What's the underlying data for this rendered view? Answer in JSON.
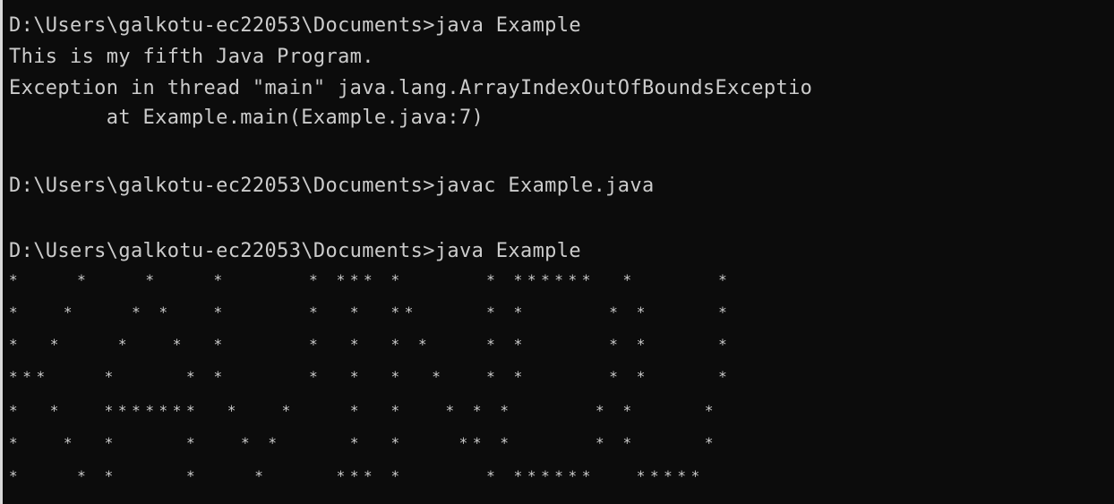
{
  "console": {
    "lines": [
      "D:\\Users\\galkotu-ec22053\\Documents>java Example",
      "This is my fifth Java Program.",
      "Exception in thread \"main\" java.lang.ArrayIndexOutOfBoundsExceptio",
      "        at Example.main(Example.java:7)",
      "D:\\Users\\galkotu-ec22053\\Documents>javac Example.java",
      "D:\\Users\\galkotu-ec22053\\Documents>java Example"
    ],
    "pattern": [
      "*    *    *    *      * *** *      * ******  *      *",
      "*   *    * *   *      *  *  **     * *      * *     *",
      "*  *    *   *  *      *  *  * *    * *      * *     *",
      "***    *     * *      *  *  *  *   * *      * *     *",
      "*  *   *******  *   *    *  *   * * *      * *     *",
      "*   *  *     *   * *     *  *    ** *      * *     *",
      "*    * *     *    *     *** *      * ******   *****"
    ]
  }
}
